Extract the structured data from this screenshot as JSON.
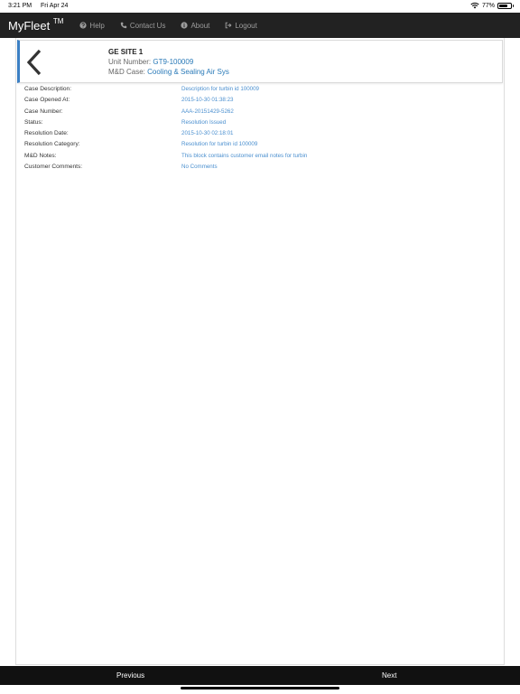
{
  "status_bar": {
    "time": "3:21 PM",
    "date": "Fri Apr 24",
    "battery_level": "77%",
    "battery_fraction": 0.77
  },
  "navbar": {
    "brand": "MyFleet",
    "brand_tm": "TM",
    "items": [
      {
        "label": "Help",
        "icon": "question-circle-icon"
      },
      {
        "label": "Contact Us",
        "icon": "phone-icon"
      },
      {
        "label": "About",
        "icon": "info-circle-icon"
      },
      {
        "label": "Logout",
        "icon": "logout-icon"
      }
    ]
  },
  "header": {
    "site": "GE SITE 1",
    "unit_label": "Unit Number:",
    "unit_value": "GT9-100009",
    "case_label": "M&D Case:",
    "case_value": "Cooling & Sealing Air Sys"
  },
  "details": [
    {
      "label": "Case Description:",
      "value": "Description for turbin id 100009"
    },
    {
      "label": "Case Opened At:",
      "value": "2015-10-30 01:38:23"
    },
    {
      "label": "Case Number:",
      "value": "AAA-20151429-5262"
    },
    {
      "label": "Status:",
      "value": "Resolution Issued"
    },
    {
      "label": "Resolution Date:",
      "value": "2015-10-30 02:18:01"
    },
    {
      "label": "Resolution Category:",
      "value": "Resolution for turbin id 100009"
    },
    {
      "label": "M&D Notes:",
      "value": "This block contains customer email notes for turbin"
    },
    {
      "label": "Customer Comments:",
      "value": "No Comments"
    }
  ],
  "footer": {
    "previous": "Previous",
    "next": "Next"
  },
  "colors": {
    "navbar_bg": "#222222",
    "accent_blue": "#3b7fc4",
    "value_blue": "#4a8fcf",
    "footer_bg": "#111111"
  }
}
